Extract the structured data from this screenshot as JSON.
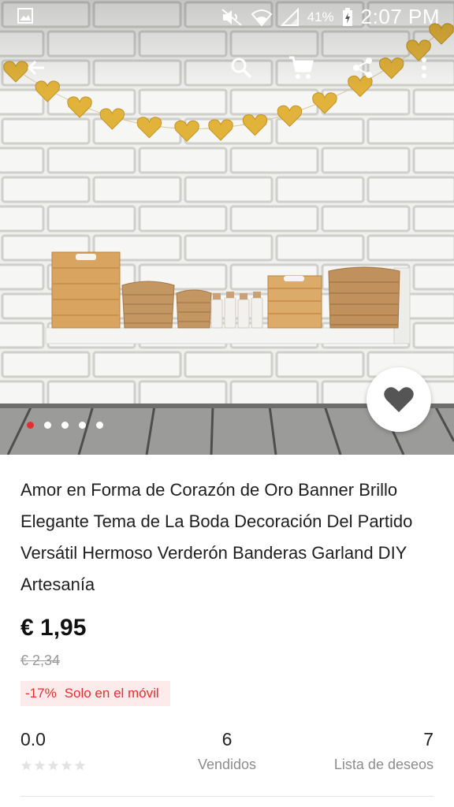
{
  "status_bar": {
    "battery_percent": "41%",
    "time": "2:07 PM",
    "icons": [
      "image-notification-icon",
      "mute-icon",
      "wifi-icon",
      "signal-icon",
      "battery-charging-icon"
    ]
  },
  "toolbar": {
    "icons": [
      "back-arrow-icon",
      "search-icon",
      "cart-icon",
      "share-icon",
      "more-vert-icon"
    ]
  },
  "gallery": {
    "image_count": 5,
    "active_index": 0,
    "favorite_icon": "heart-icon"
  },
  "product": {
    "title": "Amor en Forma de Corazón de Oro Banner Brillo Elegante Tema de La Boda Decoración Del Partido Versátil Hermoso Verderón Banderas Garland DIY Artesanía",
    "price": "€ 1,95",
    "original_price": "€ 2,34",
    "discount": "-17%",
    "promo_label": "Solo en el móvil"
  },
  "stats": {
    "rating_value": "0.0",
    "rating_stars": 0,
    "sold_count": "6",
    "sold_label": "Vendidos",
    "wishlist_count": "7",
    "wishlist_label": "Lista de deseos"
  },
  "colors": {
    "accent_red": "#e62e2e",
    "promo_bg": "#fdeaea",
    "heart_gold": "#e2b33a"
  }
}
